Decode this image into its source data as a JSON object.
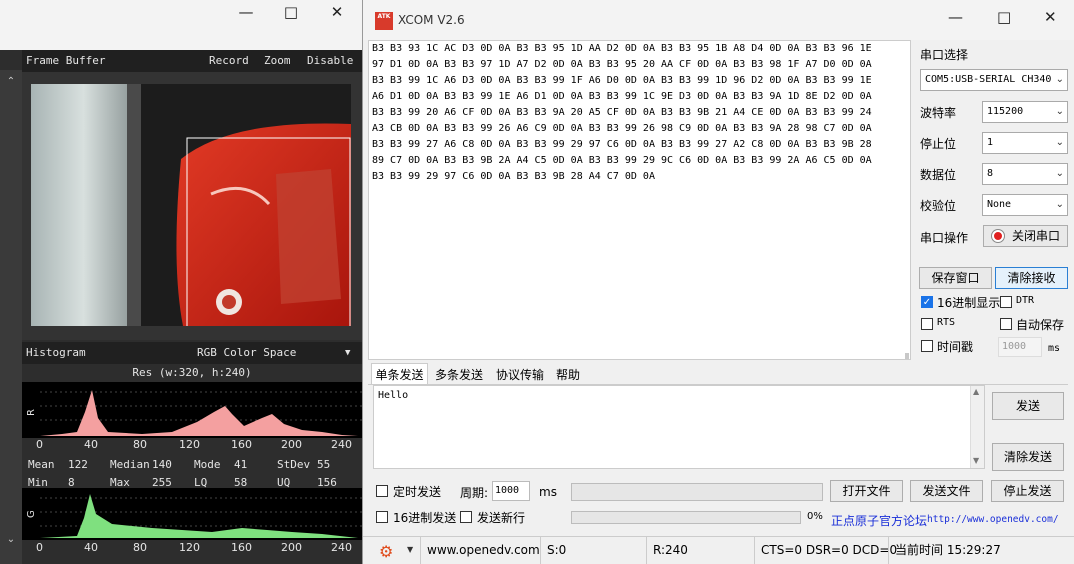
{
  "openmv": {
    "frame_buffer": {
      "title": "Frame Buffer",
      "record": "Record",
      "zoom": "Zoom",
      "disable": "Disable"
    },
    "histogram": {
      "title": "Histogram",
      "color_space": "RGB Color Space",
      "resolution": "Res (w:320, h:240)",
      "axis_ticks": [
        "0",
        "40",
        "80",
        "120",
        "160",
        "200",
        "240"
      ],
      "r": {
        "label": "R",
        "color": "#f4a0a0",
        "mean_label": "Mean",
        "mean": "122",
        "median_label": "Median",
        "median": "140",
        "mode_label": "Mode",
        "mode": "41",
        "stdev_label": "StDev",
        "stdev": "55",
        "min_label": "Min",
        "min": "8",
        "max_label": "Max",
        "max": "255",
        "lq_label": "LQ",
        "lq": "58",
        "uq_label": "UQ",
        "uq": "156"
      },
      "g": {
        "label": "G",
        "color": "#7fe07f"
      }
    }
  },
  "xcom": {
    "title": "XCOM V2.6",
    "logo_text": "ATK",
    "receive_lines": [
      "B3 B3 93 1C AC D3 0D 0A B3 B3 95 1D AA D2 0D 0A B3 B3 95 1B A8 D4 0D 0A B3 B3 96 1E",
      "97 D1 0D 0A B3 B3 97 1D A7 D2 0D 0A B3 B3 95 20 AA CF 0D 0A B3 B3 98 1F A7 D0 0D 0A",
      "B3 B3 99 1C A6 D3 0D 0A B3 B3 99 1F A6 D0 0D 0A B3 B3 99 1D 96 D2 0D 0A B3 B3 99 1E",
      "A6 D1 0D 0A B3 B3 99 1E A6 D1 0D 0A B3 B3 99 1C 9E D3 0D 0A B3 B3 9A 1D 8E D2 0D 0A",
      "B3 B3 99 20 A6 CF 0D 0A B3 B3 9A 20 A5 CF 0D 0A B3 B3 9B 21 A4 CE 0D 0A B3 B3 99 24",
      "A3 CB 0D 0A B3 B3 99 26 A6 C9 0D 0A B3 B3 99 26 98 C9 0D 0A B3 B3 9A 28 98 C7 0D 0A",
      "B3 B3 99 27 A6 C8 0D 0A B3 B3 99 29 97 C6 0D 0A B3 B3 99 27 A2 C8 0D 0A B3 B3 9B 28",
      "89 C7 0D 0A B3 B3 9B 2A A4 C5 0D 0A B3 B3 99 29 9C C6 0D 0A B3 B3 99 2A A6 C5 0D 0A",
      "B3 B3 99 29 97 C6 0D 0A B3 B3 9B 28 A4 C7 0D 0A"
    ],
    "settings": {
      "port_select_label": "串口选择",
      "port_value": "COM5:USB-SERIAL CH340",
      "baud_label": "波特率",
      "baud_value": "115200",
      "stop_label": "停止位",
      "stop_value": "1",
      "data_label": "数据位",
      "data_value": "8",
      "parity_label": "校验位",
      "parity_value": "None",
      "port_op_label": "串口操作",
      "close_port": "关闭串口",
      "save_window": "保存窗口",
      "clear_receive": "清除接收",
      "hex_display": "16进制显示",
      "dtr": "DTR",
      "rts": "RTS",
      "auto_save": "自动保存",
      "timestamp": "时间戳",
      "timestamp_value": "1000",
      "ms": "ms"
    },
    "tabs": [
      "单条发送",
      "多条发送",
      "协议传输",
      "帮助"
    ],
    "send": {
      "text": "Hello",
      "send_button": "发送",
      "clear_send_button": "清除发送",
      "timed_send": "定时发送",
      "period_label": "周期:",
      "period_value": "1000",
      "ms": "ms",
      "open_file": "打开文件",
      "send_file": "发送文件",
      "stop_send": "停止发送",
      "hex_send": "16进制发送",
      "send_newline": "发送新行",
      "progress": "0%",
      "progress_value": 0,
      "forum_label": "正点原子官方论坛",
      "forum_url": "http://www.openedv.com/"
    },
    "status": {
      "website": "www.openedv.com",
      "sent": "S:0",
      "received": "R:240",
      "lines": "CTS=0 DSR=0 DCD=0",
      "time": "当前时间 15:29:27"
    }
  }
}
